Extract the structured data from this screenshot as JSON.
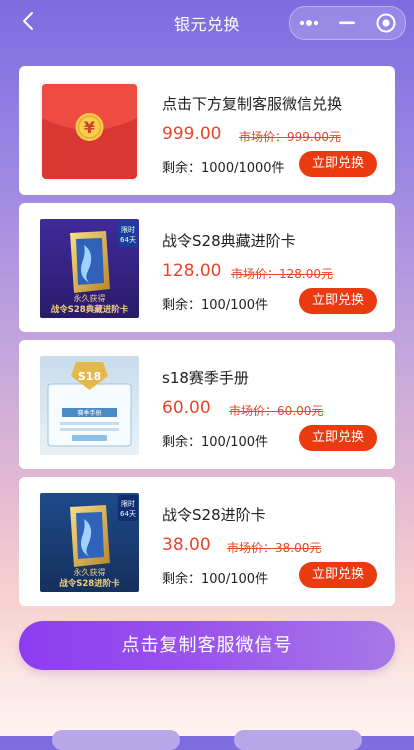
{
  "nav": {
    "title": "银元兑换",
    "back_icon": "chevron-left-icon",
    "capsule_icons": [
      "more-dots-icon",
      "minimize-icon",
      "target-icon"
    ]
  },
  "items": [
    {
      "name": "点击下方复制客服微信兑换",
      "price": "999.00",
      "market_price": "市场价：999.00元",
      "stock": "剩余：1000/1000件",
      "button": "立即兑换",
      "image": "red-envelope-icon"
    },
    {
      "name": "战令S28典藏进阶卡",
      "price": "128.00",
      "market_price": "市场价：128.00元",
      "stock": "剩余：100/100件",
      "button": "立即兑换",
      "image": "battle-pass-collector-card",
      "image_text": {
        "badge_top": "限时",
        "badge_bottom": "64天",
        "caption_top": "永久获得",
        "caption": "战令S28典藏进阶卡"
      }
    },
    {
      "name": "s18赛季手册",
      "price": "60.00",
      "market_price": "市场价：60.00元",
      "stock": "剩余：100/100件",
      "button": "立即兑换",
      "image": "season-handbook-card",
      "image_text": {
        "banner": "赛季手册",
        "plaque": "S18"
      }
    },
    {
      "name": "战令S28进阶卡",
      "price": "38.00",
      "market_price": "市场价：38.00元",
      "stock": "剩余：100/100件",
      "button": "立即兑换",
      "image": "battle-pass-advanced-card",
      "image_text": {
        "badge_top": "限时",
        "badge_bottom": "64天",
        "caption_top": "永久获得",
        "caption": "战令S28进阶卡"
      }
    }
  ],
  "cta": "点击复制客服微信号",
  "colors": {
    "price": "#e6462a",
    "button": "#ea3a10",
    "cta_start": "#8d3cf0",
    "cta_end": "#a679e6"
  }
}
